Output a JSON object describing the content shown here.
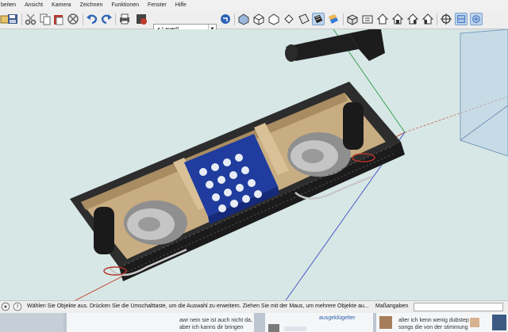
{
  "menu": {
    "items": [
      "beiten",
      "Ansicht",
      "Kamera",
      "Zeichnen",
      "Funktionen",
      "Fenster",
      "Hilfe"
    ]
  },
  "toolbar": {
    "layer": {
      "check": "✔",
      "name": "Layer0"
    }
  },
  "status": {
    "message": "Wählen Sie Objekte aus. Drücken Sie die Umschalttaste, um die Auswahl zu erweitern. Ziehen Sie mit der Maus, um mehrere Objekte au...",
    "measure_label": "Maßangaben",
    "measure_value": ""
  },
  "taskbar": {
    "chat1": {
      "line1": "awr nein sie ist auch nicht da,",
      "line2": "aber ich kanns dir bringen"
    },
    "chat2": {
      "text": "ausgeklügelter"
    },
    "chat3": {
      "line1": "alter ich kenn wenig dubstep",
      "line2": "songs die von der stimmung"
    }
  },
  "colors": {
    "background": "#d7e7e5",
    "wood": "#c9ad82",
    "box_dark": "#323232",
    "battery": "#1f3c9e",
    "red_axis": "#c0392b",
    "green_axis": "#2e9a48",
    "blue_axis": "#3b4fc4"
  }
}
